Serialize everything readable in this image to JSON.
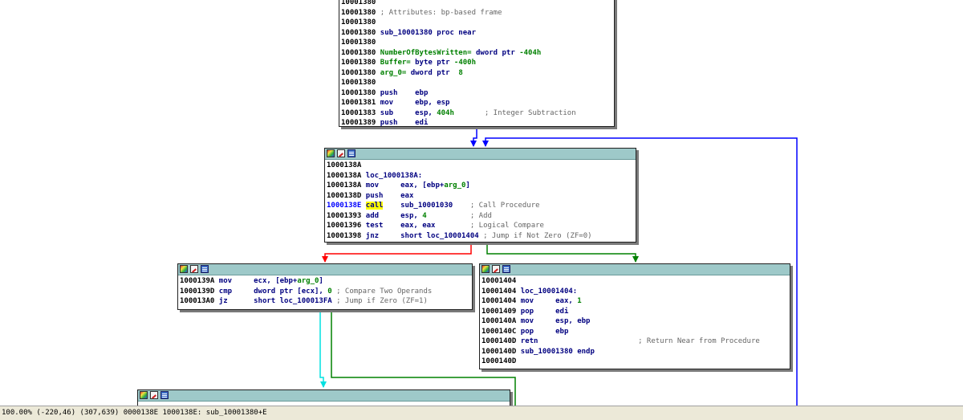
{
  "nodes": {
    "top": [
      {
        "a": "10001380",
        "t": " ; Attributes: bp-based frame",
        "k": "c"
      },
      {
        "a": "10001380",
        "t": ""
      },
      {
        "a": "10001380",
        "t": " sub_10001380 proc near"
      },
      {
        "a": "10001380",
        "t": ""
      },
      {
        "a": "10001380",
        "t": " NumberOfBytesWritten= dword ptr -404h",
        "k": "v"
      },
      {
        "a": "10001380",
        "t": " Buffer= byte ptr -400h",
        "k": "v"
      },
      {
        "a": "10001380",
        "t": " arg_0= dword ptr  8",
        "k": "v"
      },
      {
        "a": "10001380",
        "t": ""
      },
      {
        "a": "10001380",
        "t": " push    ebp"
      },
      {
        "a": "10001381",
        "t": " mov     ebp, esp"
      },
      {
        "a": "10001383",
        "t": " sub     esp, 404h",
        "c": "       ; Integer Subtraction"
      },
      {
        "a": "10001389",
        "t": " push    edi"
      }
    ],
    "loop": [
      {
        "a": "1000138A",
        "t": ""
      },
      {
        "a": "1000138A",
        "t": " loc_1000138A:"
      },
      {
        "a": "1000138A",
        "t": " mov     eax, [ebp+arg_0]"
      },
      {
        "a": "1000138D",
        "t": " push    eax"
      },
      {
        "a": "1000138E",
        "t": " call    sub_10001030",
        "c": "    ; Call Procedure",
        "cur": true
      },
      {
        "a": "10001393",
        "t": " add     esp, 4",
        "c": "          ; Add"
      },
      {
        "a": "10001396",
        "t": " test    eax, eax",
        "c": "        ; Logical Compare"
      },
      {
        "a": "10001398",
        "t": " jnz     short loc_10001404",
        "c": " ; Jump if Not Zero (ZF=0)"
      }
    ],
    "left": [
      {
        "a": "1000139A",
        "t": " mov     ecx, [ebp+arg_0]"
      },
      {
        "a": "1000139D",
        "t": " cmp     dword ptr [ecx], 0",
        "c": " ; Compare Two Operands"
      },
      {
        "a": "100013A0",
        "t": " jz      short loc_100013FA",
        "c": " ; Jump if Zero (ZF=1)"
      }
    ],
    "right": [
      {
        "a": "10001404",
        "t": ""
      },
      {
        "a": "10001404",
        "t": " loc_10001404:"
      },
      {
        "a": "10001404",
        "t": " mov     eax, 1"
      },
      {
        "a": "10001409",
        "t": " pop     edi"
      },
      {
        "a": "1000140A",
        "t": " mov     esp, ebp"
      },
      {
        "a": "1000140C",
        "t": " pop     ebp"
      },
      {
        "a": "1000140D",
        "t": " retn",
        "c": "                       ; Return Near from Procedure"
      },
      {
        "a": "1000140D",
        "t": " sub_10001380 endp"
      },
      {
        "a": "1000140D",
        "t": ""
      }
    ],
    "top_partial_addr": "10001380"
  },
  "colors": {
    "edge_true": "#008000",
    "edge_false": "#ff0000",
    "edge_uncond": "#0000ff",
    "edge_cyan": "#00e0e0",
    "titlebar": "#9ec9c9"
  },
  "status": {
    "zoom": "100.00%",
    "coords": "(-220,46) (307,639)",
    "offset": "0000138E",
    "location": "1000138E: sub_10001380+E"
  }
}
